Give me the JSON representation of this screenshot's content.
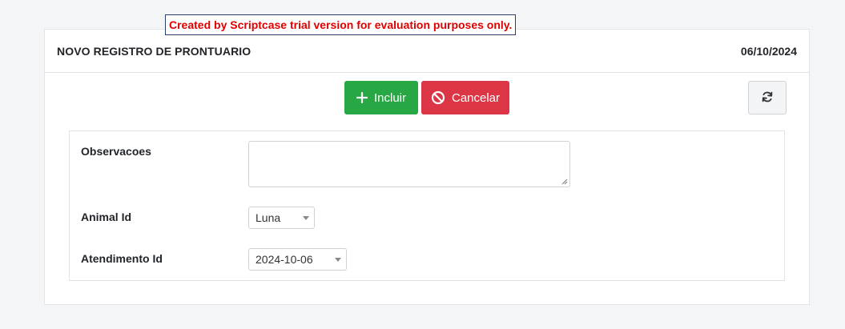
{
  "banner": {
    "text": "Created by Scriptcase trial version for evaluation purposes only."
  },
  "header": {
    "title": "NOVO REGISTRO DE PRONTUARIO",
    "date": "06/10/2024"
  },
  "toolbar": {
    "incluir_label": "Incluir",
    "cancelar_label": "Cancelar",
    "incluir_icon": "plus-icon",
    "cancelar_icon": "ban-icon",
    "refresh_icon": "refresh-icon"
  },
  "form": {
    "observacoes": {
      "label": "Observacoes",
      "value": ""
    },
    "animal_id": {
      "label": "Animal Id",
      "value": "Luna"
    },
    "atendimento_id": {
      "label": "Atendimento Id",
      "value": "2024-10-06"
    }
  },
  "colors": {
    "success": "#28a745",
    "danger": "#dc3545",
    "banner_text": "#e00000",
    "page_bg": "#f4f5f7"
  }
}
